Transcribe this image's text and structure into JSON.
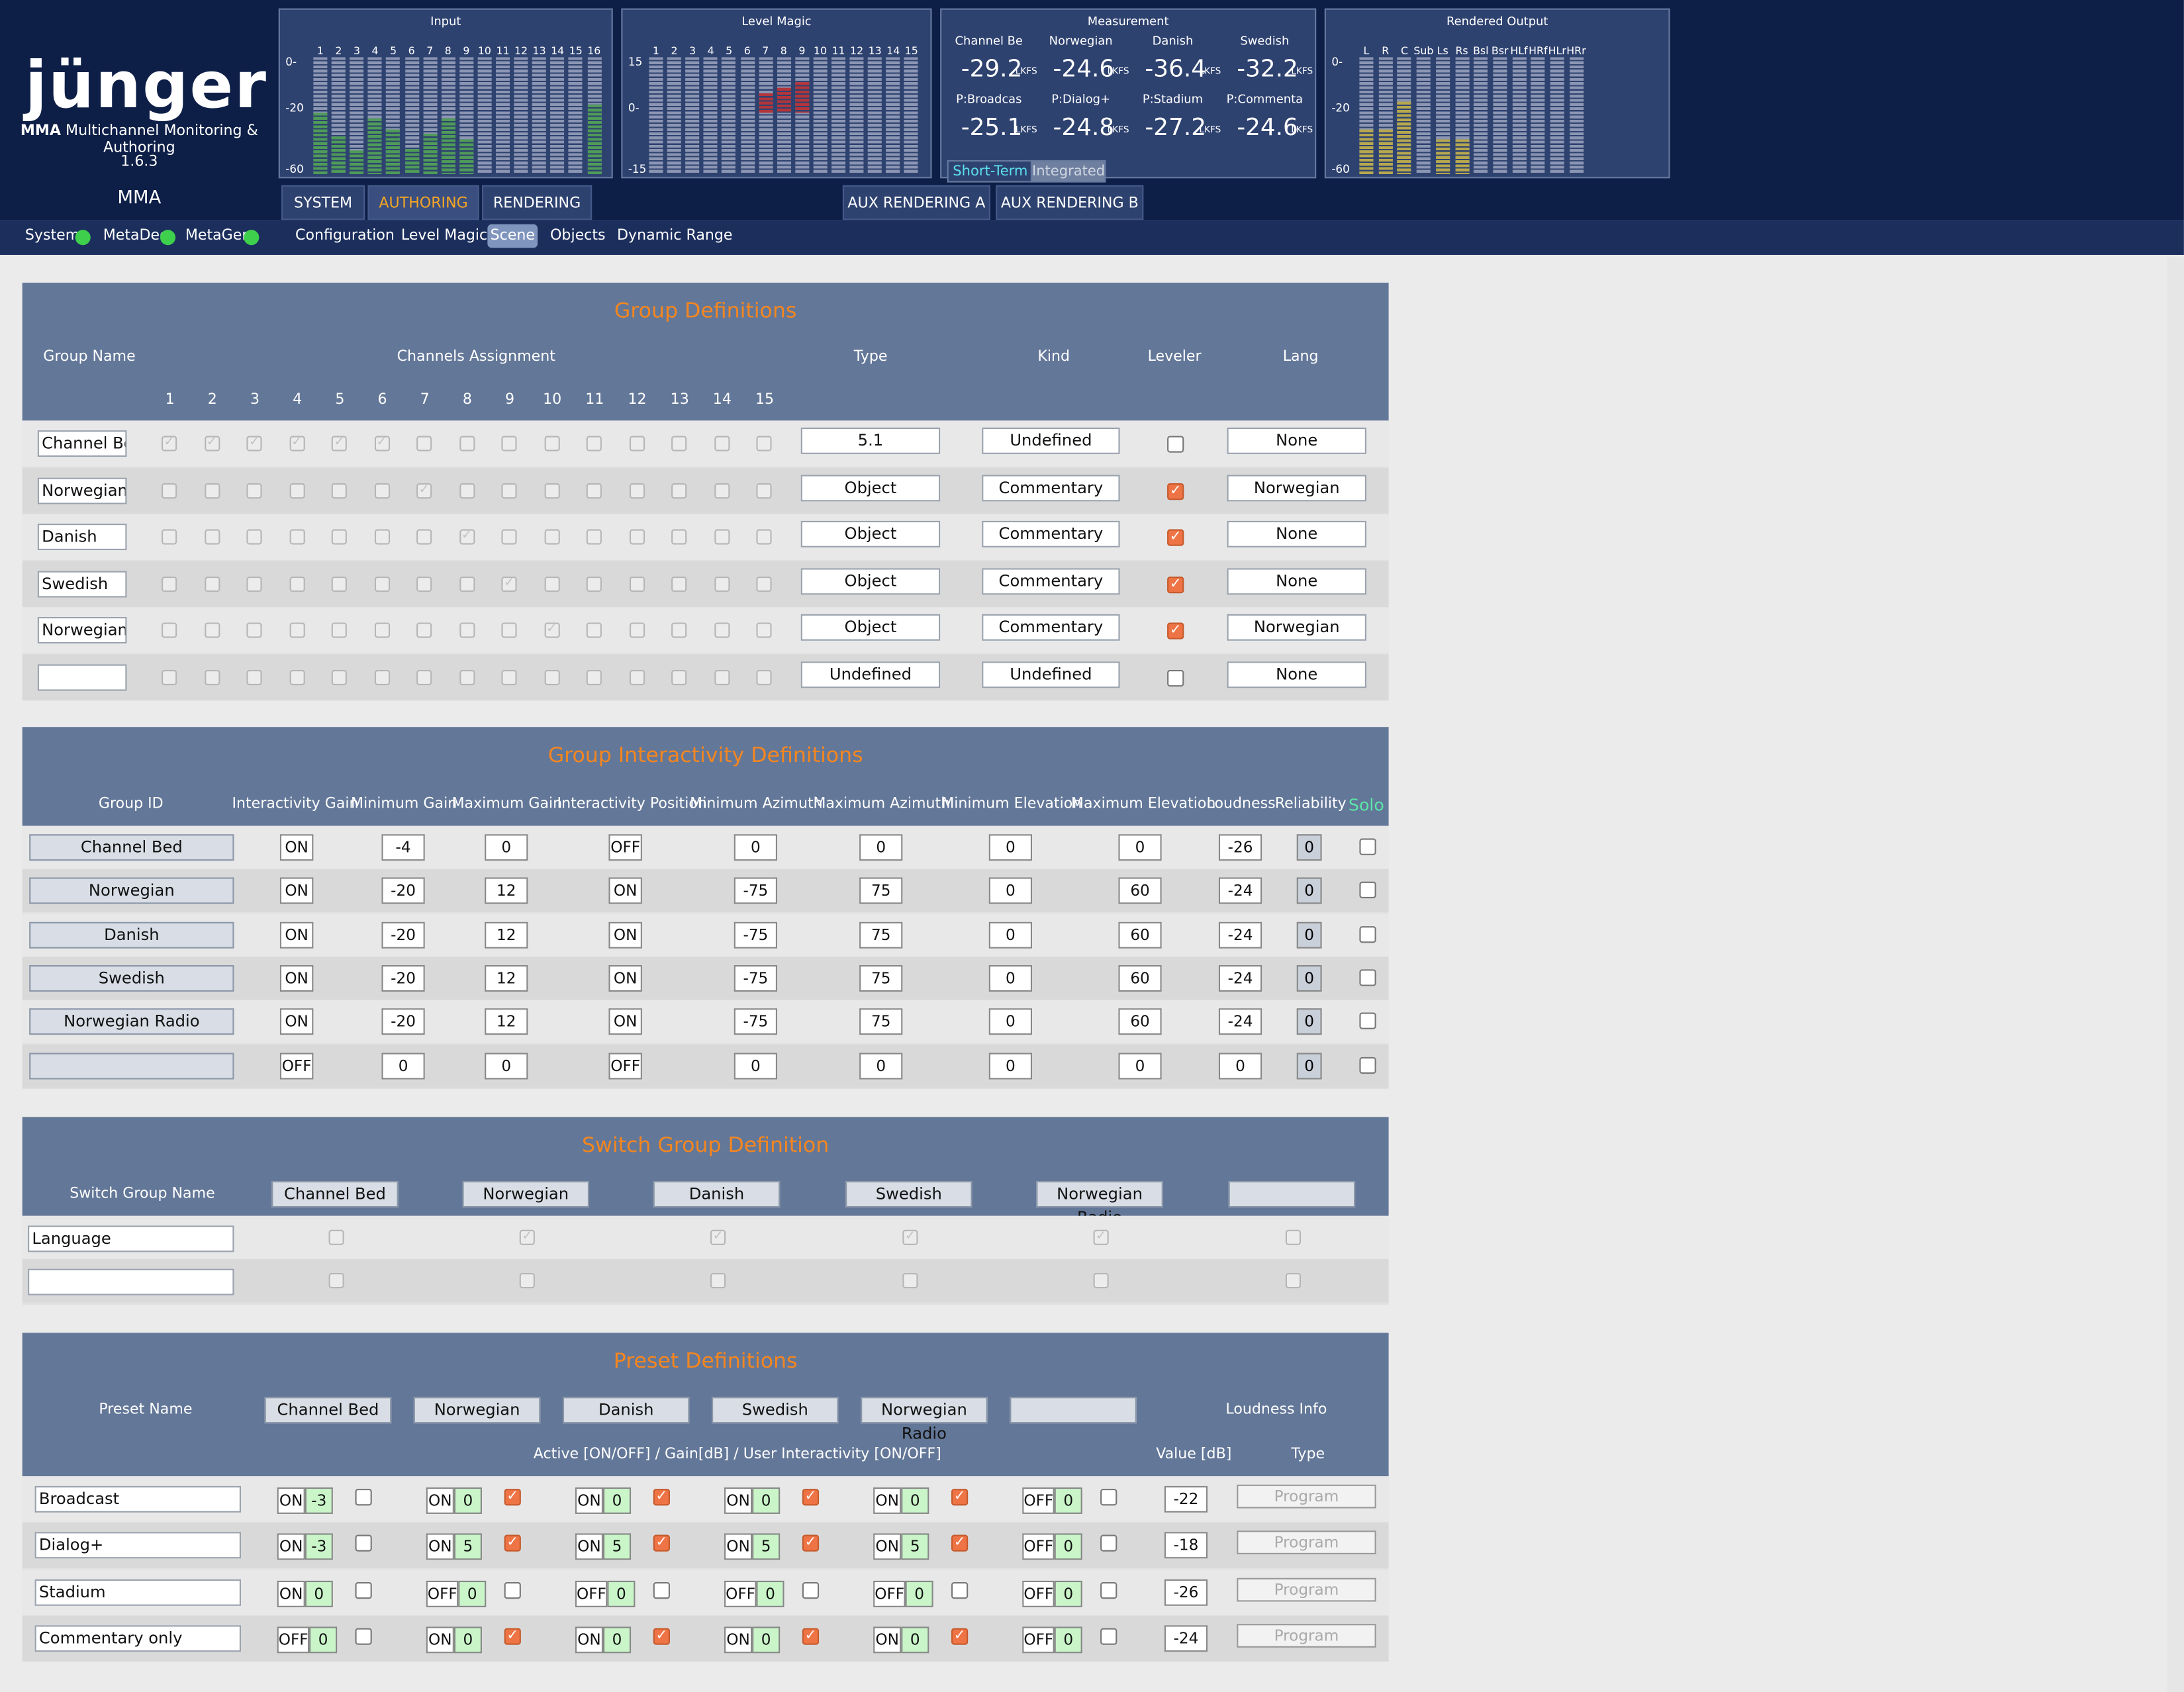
{
  "app": {
    "brand": "jünger",
    "subtitle_bold": "MMA",
    "subtitle": "Multichannel Monitoring & Authoring",
    "version": "1.6.3",
    "device": "MMA"
  },
  "meters": {
    "input": {
      "title": "Input",
      "channels": [
        "1",
        "2",
        "3",
        "4",
        "5",
        "6",
        "7",
        "8",
        "9",
        "10",
        "11",
        "12",
        "13",
        "14",
        "15",
        "16"
      ],
      "scale": [
        "0-",
        "-20",
        "-60"
      ],
      "levels": [
        0.52,
        0.32,
        0.2,
        0.48,
        0.38,
        0.22,
        0.35,
        0.48,
        0.3,
        0.0,
        0.0,
        0.0,
        0.0,
        0.0,
        0.0,
        0.6
      ]
    },
    "level_magic": {
      "title": "Level Magic",
      "channels": [
        "1",
        "2",
        "3",
        "4",
        "5",
        "6",
        "7",
        "8",
        "9",
        "10",
        "11",
        "12",
        "13",
        "14",
        "15"
      ],
      "scale": [
        "15",
        "0-",
        "-15"
      ]
    },
    "measurement": {
      "title": "Measurement",
      "items": [
        {
          "label": "Channel Be",
          "value": "-29.2",
          "unit": "LKFS"
        },
        {
          "label": "Norwegian",
          "value": "-24.6",
          "unit": "LKFS"
        },
        {
          "label": "Danish",
          "value": "-36.4",
          "unit": "LKFS"
        },
        {
          "label": "Swedish",
          "value": "-32.2",
          "unit": "LKFS"
        },
        {
          "label": "P:Broadcas",
          "value": "-25.1",
          "unit": "LKFS"
        },
        {
          "label": "P:Dialog+",
          "value": "-24.8",
          "unit": "LKFS"
        },
        {
          "label": "P:Stadium",
          "value": "-27.2",
          "unit": "LKFS"
        },
        {
          "label": "P:Commenta",
          "value": "-24.6",
          "unit": "LKFS"
        }
      ],
      "buttons": [
        "Short-Term",
        "Integrated"
      ]
    },
    "rendered": {
      "title": "Rendered Output",
      "channels": [
        "L",
        "R",
        "C",
        "Sub",
        "Ls",
        "Rs",
        "Bsl",
        "Bsr",
        "HLf",
        "HRf",
        "HLr",
        "HRr"
      ],
      "scale": [
        "0-",
        "-20",
        "-60"
      ],
      "levels": [
        0.38,
        0.38,
        0.62,
        0.0,
        0.3,
        0.3,
        0,
        0,
        0,
        0,
        0,
        0
      ]
    }
  },
  "tabs": [
    "SYSTEM",
    "AUTHORING",
    "RENDERING"
  ],
  "aux_tabs": [
    "AUX RENDERING A",
    "AUX RENDERING B"
  ],
  "status": [
    "System",
    "MetaDec",
    "MetaGen"
  ],
  "subnav": [
    "Configuration",
    "Level Magic",
    "Scene",
    "Objects",
    "Dynamic Range"
  ],
  "group_def": {
    "title": "Group Definitions",
    "headers": {
      "name": "Group Name",
      "channels": "Channels Assignment",
      "type": "Type",
      "kind": "Kind",
      "leveler": "Leveler",
      "lang": "Lang"
    },
    "channel_numbers": [
      "1",
      "2",
      "3",
      "4",
      "5",
      "6",
      "7",
      "8",
      "9",
      "10",
      "11",
      "12",
      "13",
      "14",
      "15"
    ],
    "rows": [
      {
        "name": "Channel Bed",
        "assigned": [
          1,
          2,
          3,
          4,
          5,
          6
        ],
        "type": "5.1",
        "kind": "Undefined",
        "leveler": false,
        "lang": "None"
      },
      {
        "name": "Norwegian",
        "assigned": [
          7
        ],
        "type": "Object",
        "kind": "Commentary",
        "leveler": true,
        "lang": "Norwegian"
      },
      {
        "name": "Danish",
        "assigned": [
          8
        ],
        "type": "Object",
        "kind": "Commentary",
        "leveler": true,
        "lang": "None"
      },
      {
        "name": "Swedish",
        "assigned": [
          9
        ],
        "type": "Object",
        "kind": "Commentary",
        "leveler": true,
        "lang": "None"
      },
      {
        "name": "Norwegian ...",
        "assigned": [
          10
        ],
        "type": "Object",
        "kind": "Commentary",
        "leveler": true,
        "lang": "Norwegian"
      },
      {
        "name": "",
        "assigned": [],
        "type": "Undefined",
        "kind": "Undefined",
        "leveler": false,
        "lang": "None"
      }
    ]
  },
  "interactivity": {
    "title": "Group Interactivity Definitions",
    "headers": [
      "Group ID",
      "Interactivity Gain",
      "Minimum Gain",
      "Maximum Gain",
      "Interactivity Position",
      "Minimum Azimuth",
      "Maximum Azimuth",
      "Minimum Elevation",
      "Maximum Elevation",
      "Loudness",
      "Reliability",
      "Solo"
    ],
    "rows": [
      {
        "id": "Channel Bed",
        "igain": "ON",
        "min_gain": "-4",
        "max_gain": "0",
        "ipos": "OFF",
        "min_az": "0",
        "max_az": "0",
        "min_el": "0",
        "max_el": "0",
        "loud": "-26",
        "rel": "0"
      },
      {
        "id": "Norwegian",
        "igain": "ON",
        "min_gain": "-20",
        "max_gain": "12",
        "ipos": "ON",
        "min_az": "-75",
        "max_az": "75",
        "min_el": "0",
        "max_el": "60",
        "loud": "-24",
        "rel": "0"
      },
      {
        "id": "Danish",
        "igain": "ON",
        "min_gain": "-20",
        "max_gain": "12",
        "ipos": "ON",
        "min_az": "-75",
        "max_az": "75",
        "min_el": "0",
        "max_el": "60",
        "loud": "-24",
        "rel": "0"
      },
      {
        "id": "Swedish",
        "igain": "ON",
        "min_gain": "-20",
        "max_gain": "12",
        "ipos": "ON",
        "min_az": "-75",
        "max_az": "75",
        "min_el": "0",
        "max_el": "60",
        "loud": "-24",
        "rel": "0"
      },
      {
        "id": "Norwegian Radio",
        "igain": "ON",
        "min_gain": "-20",
        "max_gain": "12",
        "ipos": "ON",
        "min_az": "-75",
        "max_az": "75",
        "min_el": "0",
        "max_el": "60",
        "loud": "-24",
        "rel": "0"
      },
      {
        "id": "",
        "igain": "OFF",
        "min_gain": "0",
        "max_gain": "0",
        "ipos": "OFF",
        "min_az": "0",
        "max_az": "0",
        "min_el": "0",
        "max_el": "0",
        "loud": "0",
        "rel": "0"
      }
    ]
  },
  "switch_group": {
    "title": "Switch Group Definition",
    "header": "Switch Group Name",
    "groups": [
      "Channel Bed",
      "Norwegian",
      "Danish",
      "Swedish",
      "Norwegian Radio",
      ""
    ],
    "rows": [
      {
        "name": "Language",
        "checked": [
          1,
          2,
          3,
          4
        ]
      },
      {
        "name": "",
        "checked": []
      }
    ]
  },
  "presets": {
    "title": "Preset Definitions",
    "header": "Preset Name",
    "groups": [
      "Channel Bed",
      "Norwegian",
      "Danish",
      "Swedish",
      "Norwegian Radio",
      ""
    ],
    "loudness_info": "Loudness Info",
    "sub_header": "Active [ON/OFF] / Gain[dB] / User Interactivity [ON/OFF]",
    "value_label": "Value [dB]",
    "type_label": "Type",
    "rows": [
      {
        "name": "Broadcast",
        "cells": [
          [
            "ON",
            "-3",
            false
          ],
          [
            "ON",
            "0",
            true
          ],
          [
            "ON",
            "0",
            true
          ],
          [
            "ON",
            "0",
            true
          ],
          [
            "ON",
            "0",
            true
          ],
          [
            "OFF",
            "0",
            false
          ]
        ],
        "value": "-22",
        "type": "Program"
      },
      {
        "name": "Dialog+",
        "cells": [
          [
            "ON",
            "-3",
            false
          ],
          [
            "ON",
            "5",
            true
          ],
          [
            "ON",
            "5",
            true
          ],
          [
            "ON",
            "5",
            true
          ],
          [
            "ON",
            "5",
            true
          ],
          [
            "OFF",
            "0",
            false
          ]
        ],
        "value": "-18",
        "type": "Program"
      },
      {
        "name": "Stadium",
        "cells": [
          [
            "ON",
            "0",
            false
          ],
          [
            "OFF",
            "0",
            false
          ],
          [
            "OFF",
            "0",
            false
          ],
          [
            "OFF",
            "0",
            false
          ],
          [
            "OFF",
            "0",
            false
          ],
          [
            "OFF",
            "0",
            false
          ]
        ],
        "value": "-26",
        "type": "Program"
      },
      {
        "name": "Commentary only",
        "cells": [
          [
            "OFF",
            "0",
            false
          ],
          [
            "ON",
            "0",
            true
          ],
          [
            "ON",
            "0",
            true
          ],
          [
            "ON",
            "0",
            true
          ],
          [
            "ON",
            "0",
            true
          ],
          [
            "OFF",
            "0",
            false
          ]
        ],
        "value": "-24",
        "type": "Program"
      }
    ]
  },
  "colors": {
    "accent": "#f5861f",
    "header_bg": "#0e1f47",
    "panel_head": "#637798",
    "led": "#3ecf4d",
    "gain_green": "#c9f5c9"
  }
}
